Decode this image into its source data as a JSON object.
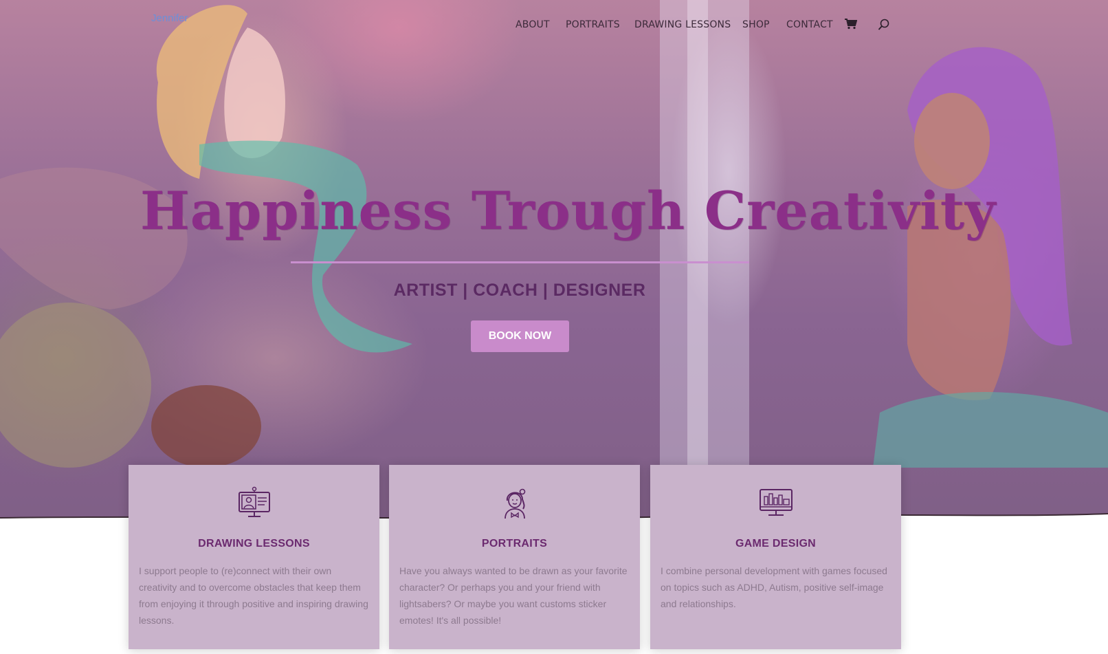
{
  "header": {
    "logo_alt": "Jennifer",
    "nav": [
      {
        "label": "ABOUT"
      },
      {
        "label": "PORTRAITS"
      },
      {
        "label": "DRAWING LESSONS"
      },
      {
        "label": "SHOP"
      },
      {
        "label": "CONTACT"
      }
    ],
    "cart_icon": "cart-icon",
    "search_icon": "search-icon"
  },
  "hero": {
    "title": "Happiness Trough Creativity",
    "subtitle": "ARTIST | COACH | DESIGNER",
    "cta_label": "BOOK NOW"
  },
  "cards": [
    {
      "icon": "online-lesson-icon",
      "title": "DRAWING LESSONS",
      "text": "I support people to (re)connect with their own creativity and to overcome obstacles that keep them from enjoying it through positive and inspiring drawing lessons."
    },
    {
      "icon": "portrait-girl-icon",
      "title": "PORTRAITS",
      "text": "Have you always wanted to be drawn as your favorite character? Or perhaps you and your friend with lightsabers? Or maybe you want customs sticker emotes! It's all possible!"
    },
    {
      "icon": "game-monitor-icon",
      "title": "GAME DESIGN",
      "text": "I combine personal development with games focused on topics such as ADHD, Autism, positive self-image and relationships."
    }
  ],
  "colors": {
    "title": "#8b2f88",
    "button": "#c98bcb",
    "card_bg": "#c9b3cb",
    "card_title": "#6b2a6f"
  }
}
